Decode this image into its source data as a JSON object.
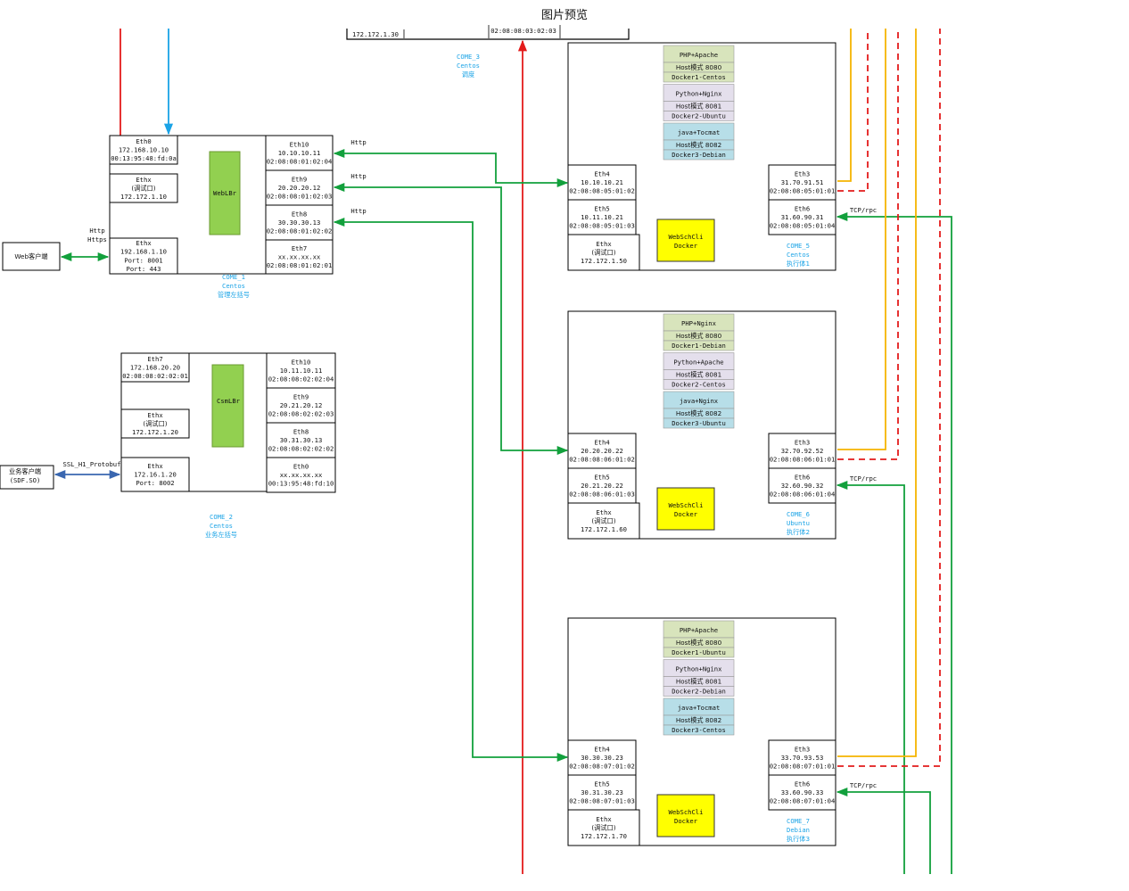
{
  "title": "图片预览",
  "top_strip": {
    "ip": "172.172.1.30",
    "mac": "02:08:08:03:02:03"
  },
  "come3": [
    "COME_3",
    "Centos",
    "调度"
  ],
  "come1": {
    "label": [
      "COME_1",
      "Centos",
      "管理左括号"
    ],
    "bridge": "WebLBr",
    "left_ports": [
      [
        "Eth0",
        "172.168.10.10",
        "00:13:95:48:fd:0a"
      ],
      [
        "Ethx",
        "(调试口)",
        "172.172.1.10"
      ],
      [
        "Ethx",
        "192.168.1.10",
        "Port: 8001",
        "Port: 443"
      ]
    ],
    "right_ports": [
      [
        "Eth10",
        "10.10.10.11",
        "02:08:08:01:02:04"
      ],
      [
        "Eth9",
        "20.20.20.12",
        "02:08:08:01:02:03"
      ],
      [
        "Eth8",
        "30.30.30.13",
        "02:08:08:01:02:02"
      ],
      [
        "Eth7",
        "xx.xx.xx.xx",
        "02:08:08:01:02:01"
      ]
    ]
  },
  "come2": {
    "label": [
      "COME_2",
      "Centos",
      "业务左括号"
    ],
    "bridge": "CsmLBr",
    "left_ports": [
      [
        "Eth7",
        "172.168.20.20",
        "02:08:08:02:02:01"
      ],
      [
        "Ethx",
        "(调试口)",
        "172.172.1.20"
      ],
      [
        "Ethx",
        "172.16.1.20",
        "Port: 8002"
      ]
    ],
    "right_ports": [
      [
        "Eth10",
        "10.11.10.11",
        "02:08:08:02:02:04"
      ],
      [
        "Eth9",
        "20.21.20.12",
        "02:08:08:02:02:03"
      ],
      [
        "Eth8",
        "30.31.30.13",
        "02:08:08:02:02:02"
      ],
      [
        "Eth0",
        "xx.xx.xx.xx",
        "00:13:95:48:fd:10"
      ]
    ]
  },
  "web_client": "Web客户端",
  "biz_client": [
    "业务客户端",
    "(SDF.SO)"
  ],
  "http_label": "Http",
  "https_label": "Https",
  "ssl_label": "SSL_H1_Protobuf",
  "tcp_label": "TCP/rpc",
  "executors": [
    {
      "label": [
        "COME_5",
        "Centos",
        "执行体1"
      ],
      "dockers": [
        [
          "PHP+Apache",
          "Host模式 8080",
          "Docker1-Centos"
        ],
        [
          "Python+Nginx",
          "Host模式 8081",
          "Docker2-Ubuntu"
        ],
        [
          "java+Tocmat",
          "Host模式 8082",
          "Docker3-Debian"
        ]
      ],
      "eth4": [
        "Eth4",
        "10.10.10.21",
        "02:08:08:05:01:02"
      ],
      "eth5": [
        "Eth5",
        "10.11.10.21",
        "02:08:08:05:01:03"
      ],
      "ethx": [
        "Ethx",
        "(调试口)",
        "172.172.1.50"
      ],
      "eth3": [
        "Eth3",
        "31.70.91.51",
        "02:08:08:05:01:01"
      ],
      "eth6": [
        "Eth6",
        "31.60.90.31",
        "02:08:08:05:01:04"
      ],
      "webschcli": [
        "WebSchCli",
        "Docker"
      ]
    },
    {
      "label": [
        "COME_6",
        "Ubuntu",
        "执行体2"
      ],
      "dockers": [
        [
          "PHP+Nginx",
          "Host模式 8080",
          "Docker1-Debian"
        ],
        [
          "Python+Apache",
          "Host模式 8081",
          "Docker2-Centos"
        ],
        [
          "java+Nginx",
          "Host模式 8082",
          "Docker3-Ubuntu"
        ]
      ],
      "eth4": [
        "Eth4",
        "20.20.20.22",
        "02:08:08:06:01:02"
      ],
      "eth5": [
        "Eth5",
        "20.21.20.22",
        "02:08:08:06:01:03"
      ],
      "ethx": [
        "Ethx",
        "(调试口)",
        "172.172.1.60"
      ],
      "eth3": [
        "Eth3",
        "32.70.92.52",
        "02:08:08:06:01:01"
      ],
      "eth6": [
        "Eth6",
        "32.60.90.32",
        "02:08:08:06:01:04"
      ],
      "webschcli": [
        "WebSchCli",
        "Docker"
      ]
    },
    {
      "label": [
        "COME_7",
        "Debian",
        "执行体3"
      ],
      "dockers": [
        [
          "PHP+Apache",
          "Host模式 8080",
          "Docker1-Ubuntu"
        ],
        [
          "Python+Nginx",
          "Host模式 8081",
          "Docker2-Debian"
        ],
        [
          "java+Tocmat",
          "Host模式 8082",
          "Docker3-Centos"
        ]
      ],
      "eth4": [
        "Eth4",
        "30.30.30.23",
        "02:08:08:07:01:02"
      ],
      "eth5": [
        "Eth5",
        "30.31.30.23",
        "02:08:08:07:01:03"
      ],
      "ethx": [
        "Ethx",
        "(调试口)",
        "172.172.1.70"
      ],
      "eth3": [
        "Eth3",
        "33.70.93.53",
        "02:08:08:07:01:01"
      ],
      "eth6": [
        "Eth6",
        "33.60.90.33",
        "02:08:08:07:01:04"
      ],
      "webschcli": [
        "WebSchCli",
        "Docker"
      ]
    }
  ],
  "colors": {
    "green": "#12a03c",
    "red": "#e31b1b",
    "blue": "#1aa3e6",
    "navy": "#3a67b0",
    "orange": "#f5b400",
    "bridge": "#92d050",
    "yellow": "#ffff00",
    "docker_a": "#d8e4bc",
    "docker_b": "#e4dfec",
    "docker_c": "#b7dee8"
  }
}
